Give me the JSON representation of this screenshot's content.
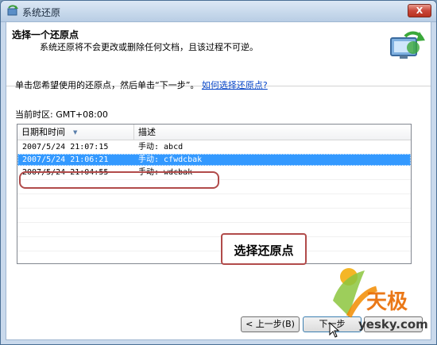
{
  "window": {
    "title": "系统还原",
    "close_label": "X"
  },
  "header": {
    "title": "选择一个还原点",
    "subtitle": "系统还原将不会更改或删除任何文档，且该过程不可逆。"
  },
  "instruction": {
    "text": "单击您希望使用的还原点，然后单击“下一步”。",
    "link": "如何选择还原点?"
  },
  "timezone": "当前时区: GMT+08:00",
  "table": {
    "columns": [
      "日期和时间",
      "描述"
    ],
    "rows": [
      {
        "date": "2007/5/24 21:07:15",
        "desc": "手动: abcd"
      },
      {
        "date": "2007/5/24 21:06:21",
        "desc": "手动: cfwdcbak"
      },
      {
        "date": "2007/5/24 21:04:55",
        "desc": "手动: wdcbak"
      }
    ]
  },
  "annotation": "选择还原点",
  "buttons": {
    "back": "< 上一步(B)",
    "next": "下一步",
    "cancel": ""
  },
  "watermark": {
    "brand": "天极",
    "domain": "yesky.com"
  },
  "colors": {
    "selection": "#3399ff",
    "annotation_border": "#b14b4a",
    "link": "#0645c8"
  }
}
